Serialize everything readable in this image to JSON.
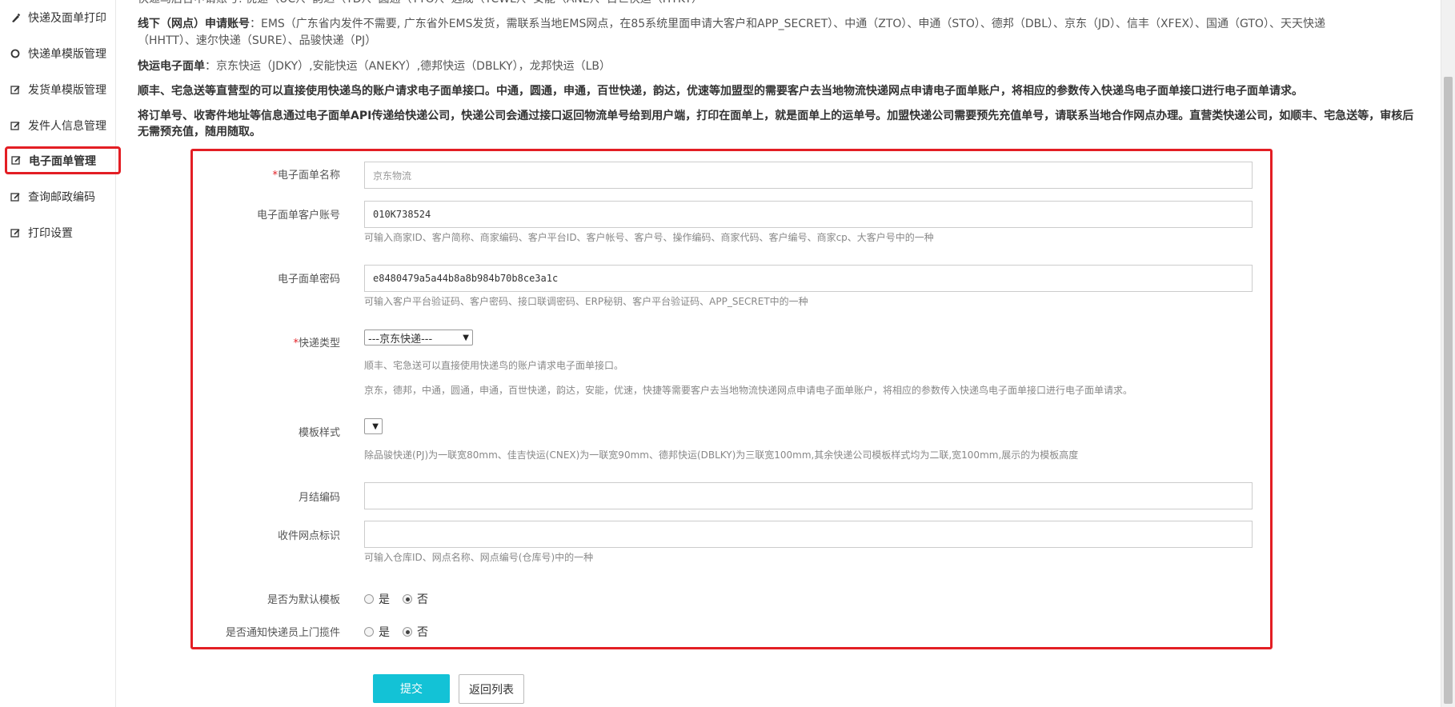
{
  "sidebar": {
    "items": [
      {
        "label": "快递及面单打印",
        "icon": "pen-icon"
      },
      {
        "label": "快递单模版管理",
        "icon": "circle-icon"
      },
      {
        "label": "发货单模版管理",
        "icon": "edit-icon"
      },
      {
        "label": "发件人信息管理",
        "icon": "edit-icon"
      },
      {
        "label": "电子面单管理",
        "icon": "edit-icon",
        "active": true
      },
      {
        "label": "查询邮政编码",
        "icon": "edit-icon"
      },
      {
        "label": "打印设置",
        "icon": "edit-icon"
      }
    ]
  },
  "info": {
    "top_cut": "快递鸟后台申请账号: 优速（UC）、韵达（YD）、圆通（YTO）、远成（YCWL）、安能（ANE）、百世快运（HTKY）",
    "offline_label": "线下（网点）申请账号",
    "offline_text": "：EMS（广东省内发件不需要, 广东省外EMS发货，需联系当地EMS网点，在85系统里面申请大客户和APP_SECRET）、中通（ZTO）、申通（STO）、德邦（DBL）、京东（JD）、信丰（XFEX）、国通（GTO）、天天快递",
    "offline_text2": "（HHTT）、速尔快递（SURE）、品骏快递（PJ）",
    "express_label": "快运电子面单",
    "express_text": "：京东快运（JDKY）,安能快运（ANEKY）,德邦快运（DBLKY），龙邦快运（LB）",
    "note1": "顺丰、宅急送等直营型的可以直接使用快递鸟的账户请求电子面单接口。中通，圆通，申通，百世快递，韵达，优速等加盟型的需要客户去当地物流快递网点申请电子面单账户，将相应的参数传入快递鸟电子面单接口进行电子面单请求。",
    "note2a": "将订单号、收寄件地址等信息通过电子面单API传递给快递公司，快递公司会通过接口返回物流单号给到用户端，打印在面单上，就是面单上的运单号。加盟快递公司需要预先充值单号，请联系当地合作网点办理。直营类快递公司，如顺丰、宅急送等，审核后",
    "note2b": "无需预充值，随用随取。"
  },
  "form": {
    "name": {
      "required": "*",
      "label": "电子面单名称",
      "placeholder": "京东物流"
    },
    "account": {
      "label": "电子面单客户账号",
      "value": "010K738524",
      "help": "可输入商家ID、客户简称、商家编码、客户平台ID、客户帐号、客户号、操作编码、商家代码、客户编号、商家cp、大客户号中的一种"
    },
    "password": {
      "label": "电子面单密码",
      "value": "e8480479a5a44b8a8b984b70b8ce3a1c",
      "help": "可输入客户平台验证码、客户密码、接口联调密码、ERP秘钥、客户平台验证码、APP_SECRET中的一种"
    },
    "type": {
      "required": "*",
      "label": "快递类型",
      "selected": "---京东快递---",
      "help1": "顺丰、宅急送可以直接使用快递鸟的账户请求电子面单接口。",
      "help2": "京东，德邦，中通，圆通，申通，百世快递，韵达，安能，优速，快捷等需要客户去当地物流快递网点申请电子面单账户，将相应的参数传入快递鸟电子面单接口进行电子面单请求。"
    },
    "template": {
      "label": "模板样式",
      "selected": "",
      "help": "除品骏快递(PJ)为一联宽80mm、佳吉快运(CNEX)为一联宽90mm、德邦快运(DBLKY)为三联宽100mm,其余快递公司模板样式均为二联,宽100mm,展示的为模板高度"
    },
    "monthly": {
      "label": "月结编码",
      "value": ""
    },
    "site": {
      "label": "收件网点标识",
      "value": "",
      "help": "可输入仓库ID、网点名称、网点编号(仓库号)中的一种"
    },
    "default_tpl": {
      "label": "是否为默认模板",
      "yes": "是",
      "no": "否",
      "selected": "no"
    },
    "notify": {
      "label": "是否通知快递员上门揽件",
      "yes": "是",
      "no": "否",
      "selected": "no"
    }
  },
  "buttons": {
    "submit": "提交",
    "back": "返回列表"
  },
  "colors": {
    "accent": "#13c2d6",
    "highlight": "#e31e24"
  }
}
